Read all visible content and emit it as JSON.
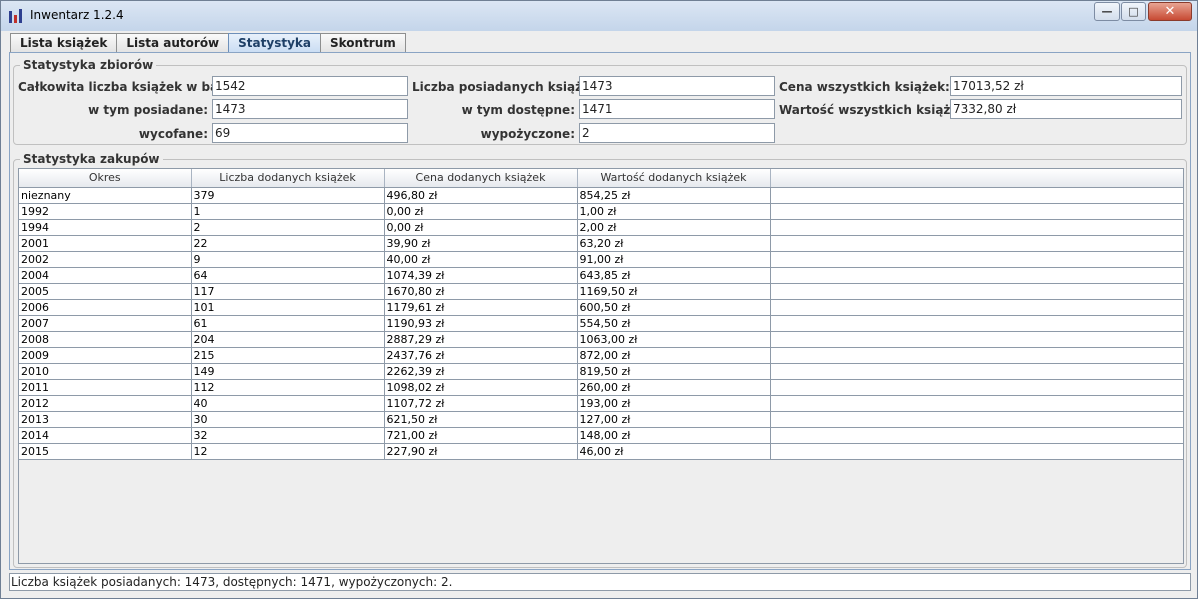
{
  "window": {
    "title": "Inwentarz 1.2.4"
  },
  "tabs": [
    {
      "label": "Lista książek"
    },
    {
      "label": "Lista autorów"
    },
    {
      "label": "Statystyka"
    },
    {
      "label": "Skontrum"
    }
  ],
  "collection_stats": {
    "title": "Statystyka zbiorów",
    "total_label": "Całkowita liczba książek w bazie:",
    "total_value": "1542",
    "owned_label": "w tym posiadane:",
    "owned_value": "1473",
    "withdrawn_label": "wycofane:",
    "withdrawn_value": "69",
    "owned_count_label": "Liczba posiadanych książek:",
    "owned_count_value": "1473",
    "available_label": "w tym dostępne:",
    "available_value": "1471",
    "borrowed_label": "wypożyczone:",
    "borrowed_value": "2",
    "price_label": "Cena wszystkich książek:",
    "price_value": "17013,52 zł",
    "worth_label": "Wartość wszystkich książek:",
    "worth_value": "7332,80 zł"
  },
  "purchase_stats": {
    "title": "Statystyka zakupów",
    "columns": [
      "Okres",
      "Liczba dodanych książek",
      "Cena dodanych książek",
      "Wartość dodanych książek"
    ],
    "rows": [
      [
        "nieznany",
        "379",
        "496,80 zł",
        "854,25 zł"
      ],
      [
        "1992",
        "1",
        "0,00 zł",
        "1,00 zł"
      ],
      [
        "1994",
        "2",
        "0,00 zł",
        "2,00 zł"
      ],
      [
        "2001",
        "22",
        "39,90 zł",
        "63,20 zł"
      ],
      [
        "2002",
        "9",
        "40,00 zł",
        "91,00 zł"
      ],
      [
        "2004",
        "64",
        "1074,39 zł",
        "643,85 zł"
      ],
      [
        "2005",
        "117",
        "1670,80 zł",
        "1169,50 zł"
      ],
      [
        "2006",
        "101",
        "1179,61 zł",
        "600,50 zł"
      ],
      [
        "2007",
        "61",
        "1190,93 zł",
        "554,50 zł"
      ],
      [
        "2008",
        "204",
        "2887,29 zł",
        "1063,00 zł"
      ],
      [
        "2009",
        "215",
        "2437,76 zł",
        "872,00 zł"
      ],
      [
        "2010",
        "149",
        "2262,39 zł",
        "819,50 zł"
      ],
      [
        "2011",
        "112",
        "1098,02 zł",
        "260,00 zł"
      ],
      [
        "2012",
        "40",
        "1107,72 zł",
        "193,00 zł"
      ],
      [
        "2013",
        "30",
        "621,50 zł",
        "127,00 zł"
      ],
      [
        "2014",
        "32",
        "721,00 zł",
        "148,00 zł"
      ],
      [
        "2015",
        "12",
        "227,90 zł",
        "46,00 zł"
      ]
    ]
  },
  "status": {
    "text": "Liczba książek posiadanych: 1473, dostępnych: 1471, wypożyczonych: 2."
  },
  "colors": {
    "active_tab": "#c9dcf3",
    "titlebar": "#c4d5ea",
    "close_button": "#c74a33"
  },
  "icons": {
    "app": "bar-chart-icon",
    "minimize": "minimize-icon",
    "maximize": "maximize-icon",
    "close": "close-icon"
  }
}
